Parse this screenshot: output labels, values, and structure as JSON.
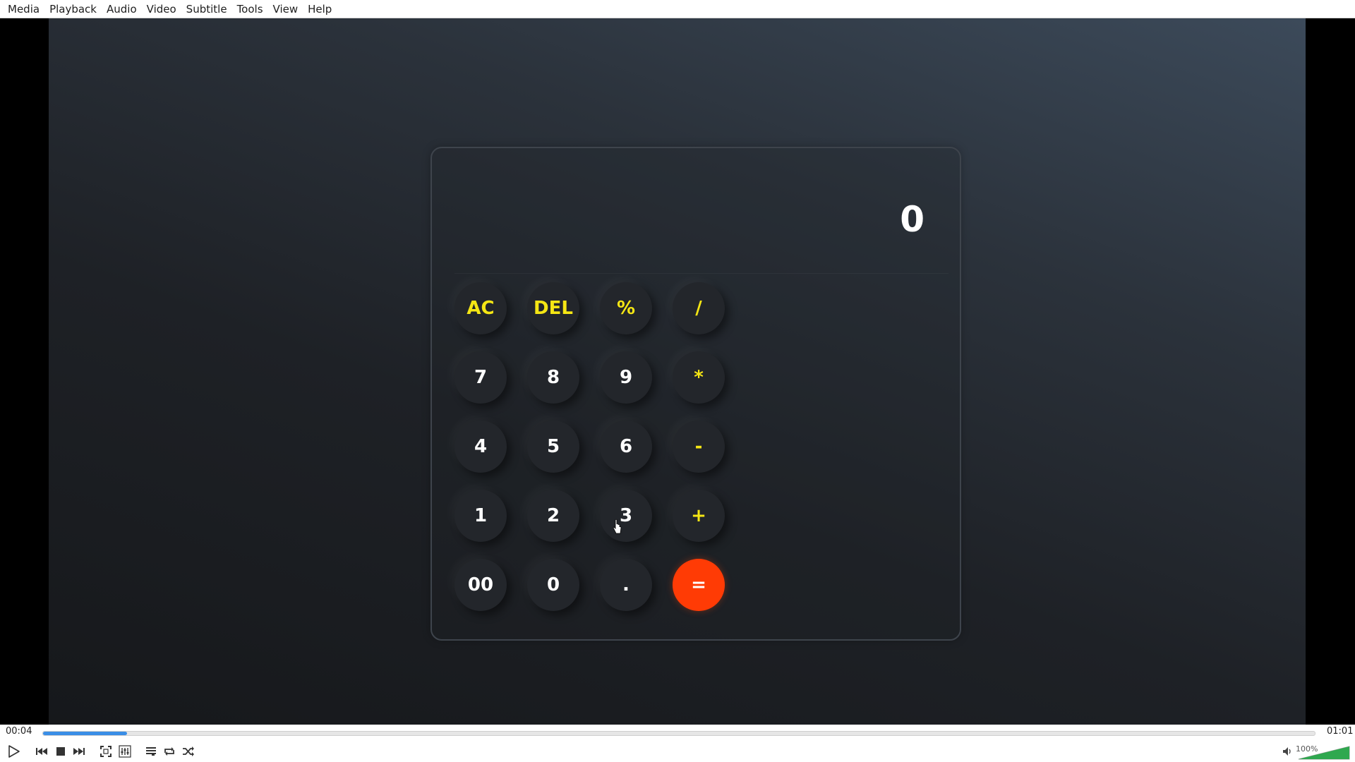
{
  "menu": [
    "Media",
    "Playback",
    "Audio",
    "Video",
    "Subtitle",
    "Tools",
    "View",
    "Help"
  ],
  "calculator": {
    "display": "0",
    "keys": [
      {
        "label": "AC",
        "kind": "op"
      },
      {
        "label": "DEL",
        "kind": "op"
      },
      {
        "label": "%",
        "kind": "op"
      },
      {
        "label": "/",
        "kind": "op"
      },
      {
        "label": "7",
        "kind": "num"
      },
      {
        "label": "8",
        "kind": "num"
      },
      {
        "label": "9",
        "kind": "num"
      },
      {
        "label": "*",
        "kind": "op"
      },
      {
        "label": "4",
        "kind": "num"
      },
      {
        "label": "5",
        "kind": "num"
      },
      {
        "label": "6",
        "kind": "num"
      },
      {
        "label": "-",
        "kind": "op"
      },
      {
        "label": "1",
        "kind": "num"
      },
      {
        "label": "2",
        "kind": "num"
      },
      {
        "label": "3",
        "kind": "num"
      },
      {
        "label": "+",
        "kind": "op"
      },
      {
        "label": "00",
        "kind": "num"
      },
      {
        "label": "0",
        "kind": "num"
      },
      {
        "label": ".",
        "kind": "num"
      },
      {
        "label": "=",
        "kind": "eq"
      }
    ]
  },
  "player": {
    "elapsed": "00:04",
    "total": "01:01",
    "progress_fraction": 0.066,
    "volume": "100%",
    "accent": "#3a8ee6"
  },
  "icons": [
    "play-icon",
    "previous-icon",
    "stop-icon",
    "next-icon",
    "fullscreen-icon",
    "extended-settings-icon",
    "playlist-icon",
    "loop-icon",
    "shuffle-icon",
    "speaker-icon"
  ]
}
